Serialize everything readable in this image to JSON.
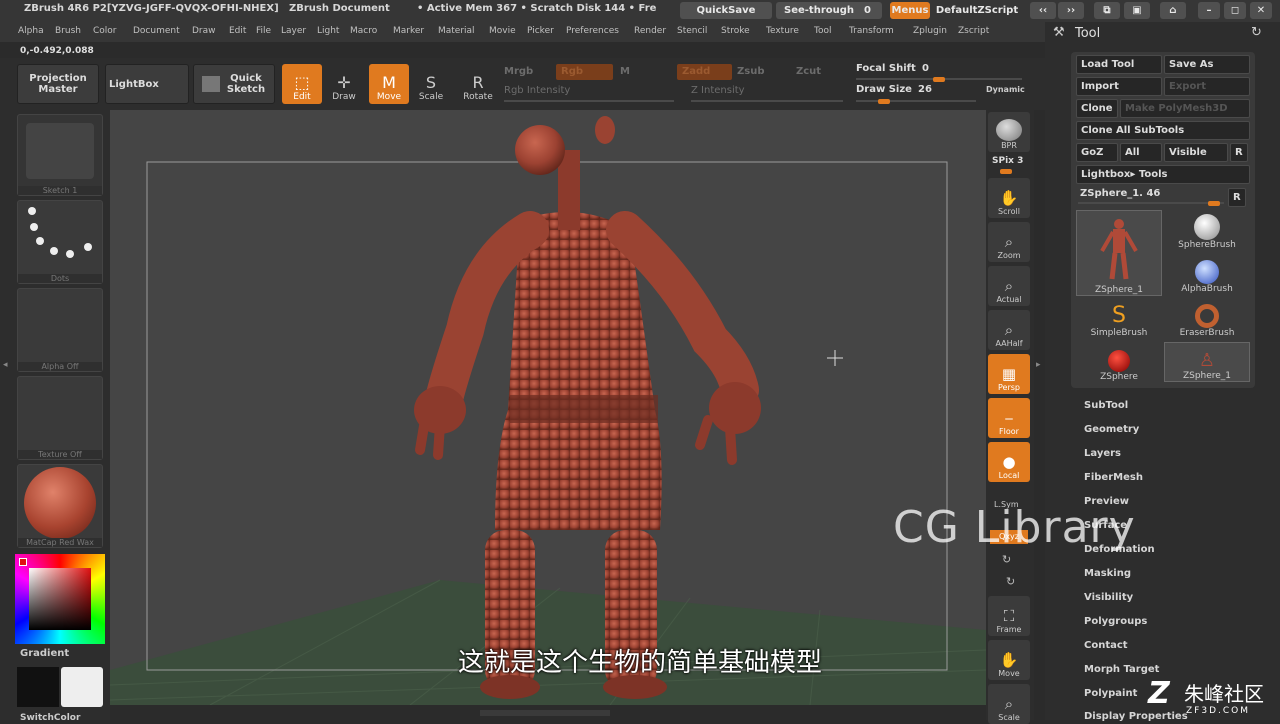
{
  "titlebar": {
    "app_title": "ZBrush 4R6 P2[YZVG-JGFF-QVQX-OFHI-NHEX]",
    "document": "ZBrush Document",
    "memory": "• Active Mem 367 • Scratch Disk 144 • Fre",
    "quicksave": "QuickSave",
    "seethrough": "See-through",
    "seethrough_value": "0",
    "menus": "Menus",
    "script": "DefaultZScript"
  },
  "menubar": [
    "Alpha",
    "Brush",
    "Color",
    "Document",
    "Draw",
    "Edit",
    "File",
    "Layer",
    "Light",
    "Macro",
    "Marker",
    "Material",
    "Movie",
    "Picker",
    "Preferences",
    "Render",
    "Stencil",
    "Stroke",
    "Texture",
    "Tool",
    "Transform",
    "Zplugin",
    "Zscript"
  ],
  "coords": "0,-0.492,0.088",
  "toolbar": {
    "projection_master": "Projection Master",
    "lightbox": "LightBox",
    "quick_sketch": "Quick Sketch",
    "edit": "Edit",
    "draw": "Draw",
    "move": "Move",
    "scale": "Scale",
    "rotate": "Rotate",
    "mrgb": "Mrgb",
    "rgb": "Rgb",
    "m": "M",
    "zadd": "Zadd",
    "zsub": "Zsub",
    "zcut": "Zcut",
    "rgb_intensity": "Rgb Intensity",
    "z_intensity": "Z Intensity",
    "focal_shift_label": "Focal Shift",
    "focal_shift_value": "0",
    "draw_size_label": "Draw Size",
    "draw_size_value": "26",
    "dynamic": "Dynamic"
  },
  "leftpanel": {
    "sketch": "Sketch 1",
    "dots": "Dots",
    "alpha": "Alpha Off",
    "texture": "Texture Off",
    "matcap": "MatCap Red Wax",
    "gradient": "Gradient",
    "switchcolor": "SwitchColor"
  },
  "rightbar": {
    "bpr": "BPR",
    "spix_label": "SPix",
    "spix_value": "3",
    "scroll": "Scroll",
    "zoom": "Zoom",
    "actual": "Actual",
    "aahalf": "AAHalf",
    "persp": "Persp",
    "floor": "Floor",
    "local": "Local",
    "lsym": "L.Sym",
    "xyz": "Qxyz",
    "frame": "Frame",
    "move": "Move",
    "scale": "Scale"
  },
  "toolpanel": {
    "title": "Tool",
    "load_tool": "Load Tool",
    "save_as": "Save As",
    "import": "Import",
    "export": "Export",
    "clone": "Clone",
    "make_polymesh": "Make PolyMesh3D",
    "clone_all": "Clone All SubTools",
    "goz": "GoZ",
    "all": "All",
    "visible": "Visible",
    "r": "R",
    "lightbox_tools": "Lightbox▸ Tools",
    "current_tool": "ZSphere_1. 46",
    "brushes": [
      {
        "label": "ZSphere_1"
      },
      {
        "label": "SphereBrush"
      },
      {
        "label": "AlphaBrush"
      },
      {
        "label": "SimpleBrush"
      },
      {
        "label": "EraserBrush"
      },
      {
        "label": "ZSphere"
      },
      {
        "label": "ZSphere_1"
      }
    ],
    "sections": [
      "SubTool",
      "Geometry",
      "Layers",
      "FiberMesh",
      "Preview",
      "Surface",
      "Deformation",
      "Masking",
      "Visibility",
      "Polygroups",
      "Contact",
      "Morph Target",
      "Polypaint",
      "Display Properties"
    ]
  },
  "subtitle": "这就是这个生物的简单基础模型",
  "watermark": "CG Library",
  "logo_text": "朱峰社区",
  "logo_sub": "ZF3D.COM",
  "colors": {
    "accent": "#e07a1f",
    "figure": "#a54a3c",
    "panel": "#2d2d2d"
  }
}
